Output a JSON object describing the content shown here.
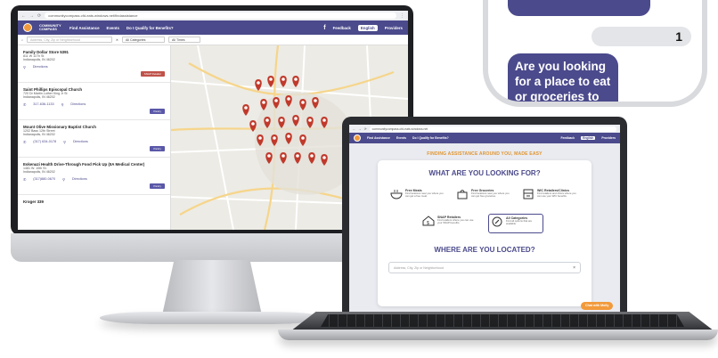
{
  "desktop": {
    "url": "communitycompass.cfd-eats.windows.net/findassistance",
    "nav": {
      "logo": "COMMUNITY COMPASS",
      "find_assistance": "Find Assistance",
      "events": "Events",
      "qualify": "Do I Qualify for Benefits?",
      "facebook": "f",
      "feedback": "Feedback",
      "language": "English",
      "providers": "Providers"
    },
    "filters": {
      "search_placeholder": "Address, City, Zip or Neighborhood",
      "category": "All Categories",
      "times": "All Times"
    },
    "locations": [
      {
        "name": "Family Dollar Store 5391",
        "addr1": "811 W 11Th St",
        "addr2": "Indianapolis, IN 46202",
        "phone": "",
        "directions": "Directions",
        "badge": "SNAP Retailer"
      },
      {
        "name": "Saint Phillips Episcopal Church",
        "addr1": "720 Dr Martin Luther King Jr St",
        "addr2": "Indianapolis, IN 46202",
        "phone": "317-636-1133",
        "directions": "Directions",
        "badge": "Pantry"
      },
      {
        "name": "Mount Olive Missionary Baptist Church",
        "addr1": "1202 Bass 12th Street",
        "addr2": "Indianapolis, IN 46202",
        "phone": "(317) 634-0178",
        "directions": "Directions",
        "badge": "Pantry"
      },
      {
        "name": "Eskenazi Health Drive-Through Food Pick Up (IIA Medical Center)",
        "addr1": "1481 W. 10th St.",
        "addr2": "Indianapolis, IN 46202",
        "phone": "(317)880-0670",
        "directions": "Directions",
        "badge": "Pantry"
      },
      {
        "name": "Kroger 339",
        "addr1": "",
        "addr2": "",
        "phone": "",
        "directions": "",
        "badge": ""
      }
    ]
  },
  "laptop": {
    "url": "communitycompass.cfd-eats.windows.net",
    "nav": {
      "find_assistance": "Find Assistance",
      "events": "Events",
      "qualify": "Do I Qualify for Benefits?",
      "feedback": "Feedback",
      "language": "English",
      "providers": "Providers"
    },
    "banner": "FINDING ASSISTANCE AROUND YOU, MADE EASY",
    "question_what": "WHAT ARE YOU LOOKING FOR?",
    "categories": [
      {
        "title": "Free Meals",
        "desc": "Find locations near you where you can get a free meal."
      },
      {
        "title": "Free Groceries",
        "desc": "Find locations near you where you can get free groceries."
      },
      {
        "title": "WIC Retailers/Clinics",
        "desc": "Find retailers and clinics where you can use your WIC benefits."
      },
      {
        "title": "SNAP Retailers",
        "desc": "Find retailers where you can use your SNAP benefits."
      },
      {
        "title": "All Categories",
        "desc": "Find all options that are available."
      }
    ],
    "question_where": "WHERE ARE YOU LOCATED?",
    "location_placeholder": "Address, City, Zip or Neighborhood",
    "chat_button": "Chat with Molly"
  },
  "phone": {
    "count": "1",
    "question": "Are you looking for a place to eat or groceries to take home?"
  },
  "colors": {
    "brand_purple": "#4b4a8c",
    "accent_orange": "#f29a3b",
    "pin_red": "#c0392b"
  }
}
